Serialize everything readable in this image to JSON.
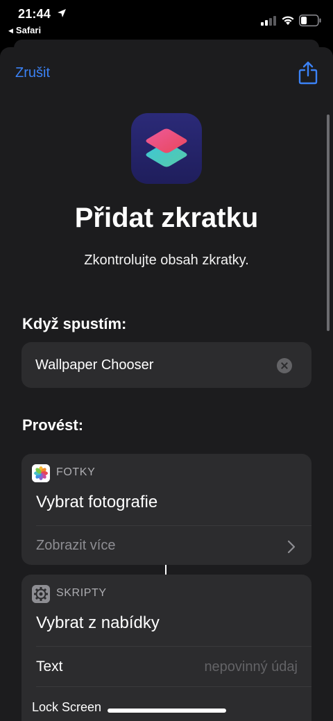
{
  "status": {
    "time": "21:44",
    "back_app": "Safari"
  },
  "header": {
    "cancel_label": "Zrušit",
    "share_icon": "share-icon"
  },
  "hero": {
    "title": "Přidat zkratku",
    "subtitle": "Zkontrolujte obsah zkratky."
  },
  "when_section": {
    "label": "Když spustím:",
    "shortcut_name": "Wallpaper Chooser"
  },
  "do_section": {
    "label": "Provést:",
    "actions": [
      {
        "app_name": "FOTKY",
        "app_icon": "photos-icon",
        "title": "Vybrat fotografie",
        "show_more": "Zobrazit více"
      },
      {
        "app_name": "SKRIPTY",
        "app_icon": "gear-icon",
        "title": "Vybrat z nabídky",
        "param_label": "Text",
        "param_placeholder": "nepovinný údaj",
        "menu_item": "Lock Screen"
      }
    ]
  },
  "colors": {
    "accent": "#3b82f6",
    "sheet_bg": "#1c1c1e",
    "card_bg": "#2c2c2e"
  }
}
